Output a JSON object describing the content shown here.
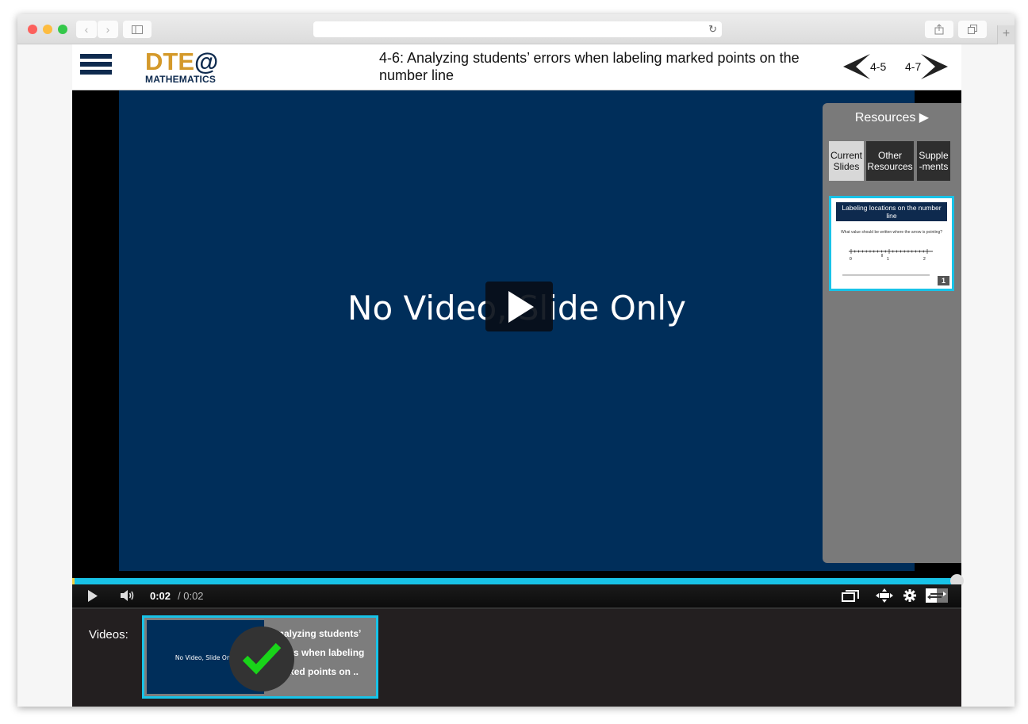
{
  "browser": {
    "url": "",
    "icons": {
      "back": "chevron-left-icon",
      "forward": "chevron-right-icon",
      "sidebar": "sidebar-icon",
      "reload": "reload-icon",
      "share": "share-icon",
      "tabs": "tabs-icon",
      "new_tab": "plus-icon"
    },
    "glyphs": {
      "back": "‹",
      "forward": "›",
      "reload": "↻",
      "new_tab": "+"
    }
  },
  "header": {
    "logo_top": "DTE",
    "logo_at": "@",
    "logo_bottom": "MATHEMATICS",
    "title": "4-6: Analyzing students’ errors when labeling marked points on the number line",
    "prev_label": "4-5",
    "next_label": "4-7",
    "colors": {
      "logo_gold": "#d4992a",
      "logo_navy": "#0e2a4e"
    }
  },
  "player": {
    "slide_text": "No Video, Slide Only",
    "current_time": "0:02",
    "total_time": "/ 0:02",
    "progress_fraction": 1.0,
    "colors": {
      "slide_bg": "#002e5a",
      "progress": "#18c3e8"
    }
  },
  "resources": {
    "title": "Resources ▶",
    "tabs": [
      {
        "label": "Current Slides",
        "active": true
      },
      {
        "label": "Other Resources",
        "active": false
      },
      {
        "label": "Supple -ments",
        "active": false
      }
    ],
    "slide_thumb": {
      "heading": "Labeling locations on the number line",
      "question": "What value should be written where the arrow is pointing?",
      "ticks": [
        "0",
        "1",
        "2"
      ],
      "number": "1"
    }
  },
  "videos": {
    "label": "Videos:",
    "items": [
      {
        "thumb_text": "No Video, Slide Only",
        "title": "Analyzing students’ errors when labeling marked points on ..",
        "watched": true
      }
    ]
  }
}
